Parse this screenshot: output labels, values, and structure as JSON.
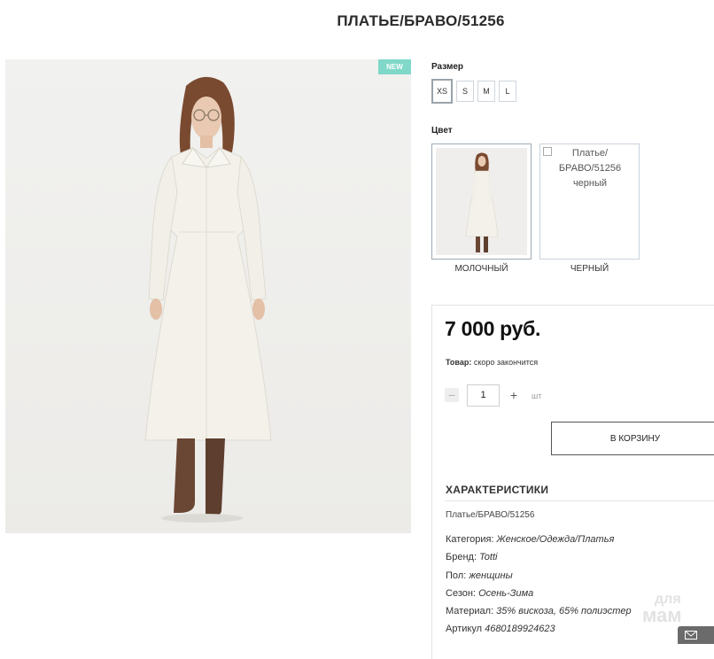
{
  "product": {
    "title": "ПЛАТЬЕ/БРАВО/51256",
    "badge": "NEW",
    "price": "7 000 руб."
  },
  "size": {
    "label": "Размер",
    "options": [
      "XS",
      "S",
      "M",
      "L"
    ],
    "selected": "XS"
  },
  "color": {
    "label": "Цвет",
    "options": [
      {
        "caption": "МОЛОЧНЫЙ",
        "selected": true
      },
      {
        "caption": "ЧЕРНЫЙ",
        "alt": "Платье/ БРАВО/51256 черный",
        "selected": false
      }
    ]
  },
  "stock": {
    "label": "Товар:",
    "value": "скоро закончится"
  },
  "quantity": {
    "value": "1",
    "unit": "шт",
    "minus": "−",
    "plus": "+"
  },
  "cart": {
    "label": "В КОРЗИНУ"
  },
  "characteristics": {
    "title": "ХАРАКТЕРИСТИКИ",
    "name": "Платье/БРАВО/51256",
    "rows": [
      {
        "key": "Категория:",
        "value": "Женское/Одежда/Платья"
      },
      {
        "key": "Бренд:",
        "value": "Totti"
      },
      {
        "key": "Пол:",
        "value": "женщины"
      },
      {
        "key": "Сезон:",
        "value": "Осень-Зима"
      },
      {
        "key": "Материал:",
        "value": "35% вискоза, 65% полиэстер"
      },
      {
        "key": "Артикул",
        "value": "4680189924623"
      }
    ]
  },
  "watermark": {
    "line1": "для",
    "line2": "мам"
  },
  "icons": {
    "mail": "mail-icon",
    "broken_image": "broken-image-icon"
  },
  "colors": {
    "badge_bg": "#7fd8c8",
    "dress": "#f3f1ea",
    "boots": "#6a4634",
    "hair": "#7a4a30"
  }
}
